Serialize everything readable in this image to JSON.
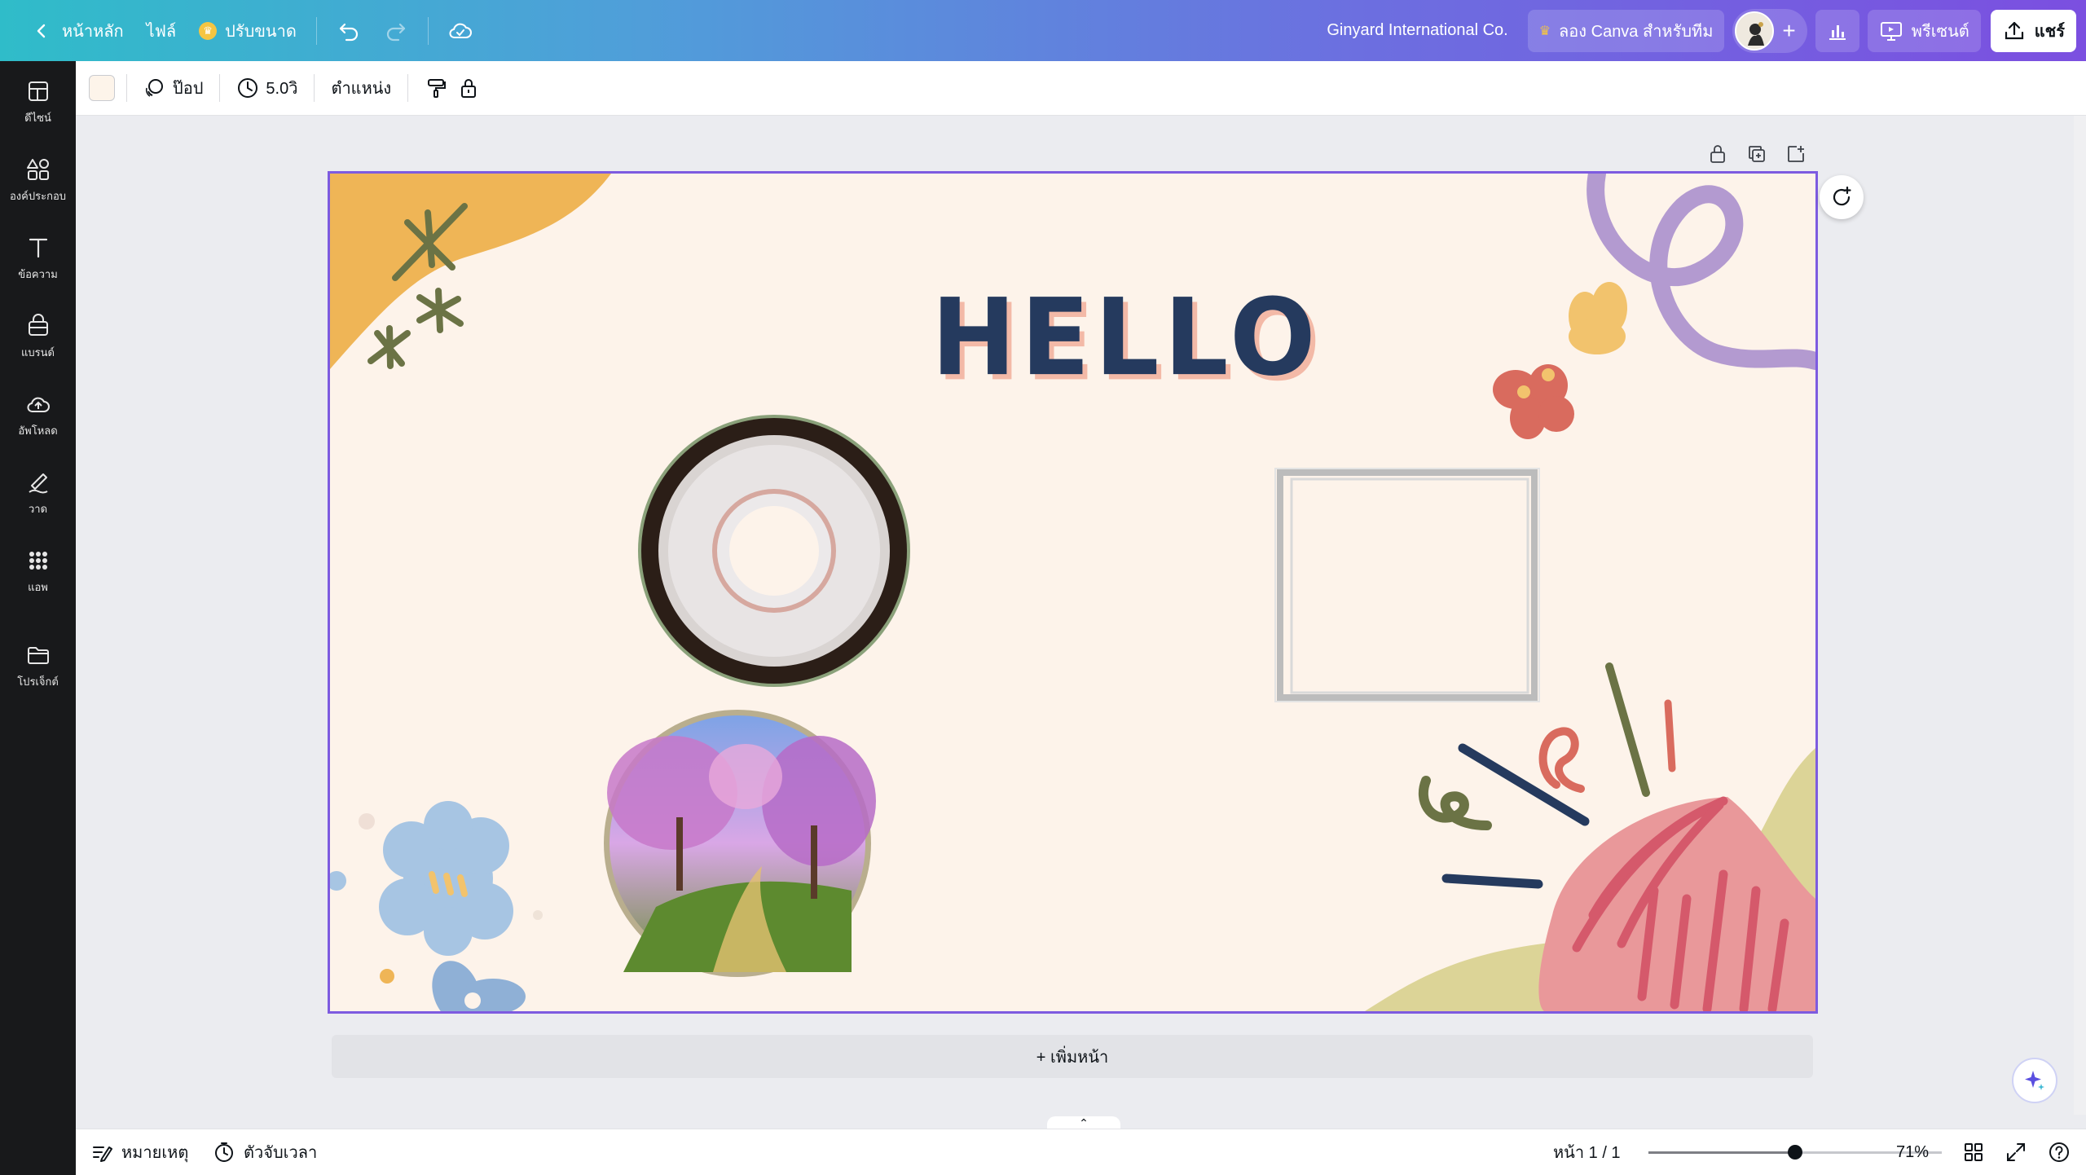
{
  "topbar": {
    "home_label": "หน้าหลัก",
    "file_label": "ไฟล์",
    "resize_label": "ปรับขนาด",
    "team_name": "Ginyard International Co.",
    "try_canva_label": "ลอง Canva สำหรับทีม",
    "present_label": "พรีเซนต์",
    "share_label": "แชร์"
  },
  "sidebar": {
    "items": [
      {
        "label": "ดีไซน์",
        "icon": "layout-icon"
      },
      {
        "label": "องค์ประกอบ",
        "icon": "shapes-icon"
      },
      {
        "label": "ข้อความ",
        "icon": "text-icon"
      },
      {
        "label": "แบรนด์",
        "icon": "brand-icon"
      },
      {
        "label": "อัพโหลด",
        "icon": "upload-cloud-icon"
      },
      {
        "label": "วาด",
        "icon": "draw-icon"
      },
      {
        "label": "แอพ",
        "icon": "apps-grid-icon"
      },
      {
        "label": "โปรเจ็กต์",
        "icon": "folder-icon"
      }
    ]
  },
  "toolbar": {
    "bg_color": "#fdf4ea",
    "animate_label": "ป๊อป",
    "duration_label": "5.0วิ",
    "position_label": "ตำแหน่ง"
  },
  "canvas": {
    "headline": "HELLO",
    "background": "#fdf3ea",
    "selection_color": "#7d5be0"
  },
  "add_page_label": "+ เพิ่มหน้า",
  "bottombar": {
    "notes_label": "หมายเหตุ",
    "timer_label": "ตัวจับเวลา",
    "page_indicator": "หน้า 1 / 1",
    "zoom_label": "71%",
    "zoom_fraction": 0.5
  }
}
